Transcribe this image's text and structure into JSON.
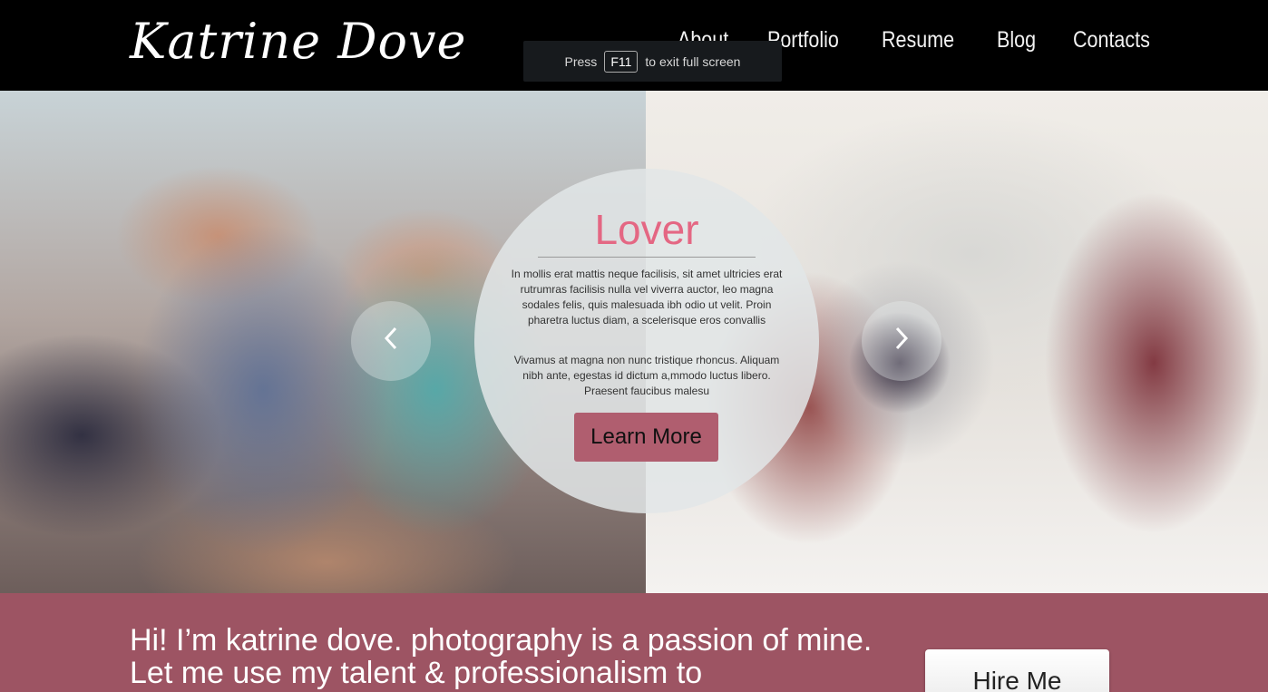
{
  "header": {
    "logo": "Katrine Dove",
    "nav": [
      "About",
      "Portfolio",
      "Resume",
      "Blog",
      "Contacts"
    ]
  },
  "fullscreen_toast": {
    "before": "Press",
    "key": "F11",
    "after": "to exit full screen"
  },
  "hero": {
    "title": "Lover",
    "paragraph1": "In mollis erat mattis neque facilisis, sit amet ultricies erat rutrumras facilisis nulla vel viverra auctor, leo magna sodales felis, quis malesuada ibh odio ut velit. Proin pharetra luctus diam, a scelerisque eros convallis",
    "paragraph2": "Vivamus at magna non nunc tristique rhoncus. Aliquam nibh ante, egestas id dictum a,mmodo luctus libero. Praesent faucibus malesu",
    "button": "Learn More",
    "prev_icon": "chevron-left-icon",
    "next_icon": "chevron-right-icon"
  },
  "band": {
    "intro": "Hi! I’m katrine dove. photography is a passion of mine. Let me use my talent & professionalism to",
    "button": "Hire Me"
  },
  "colors": {
    "accent": "#e46783",
    "band": "#9d5463",
    "button": "#b05e6f"
  }
}
